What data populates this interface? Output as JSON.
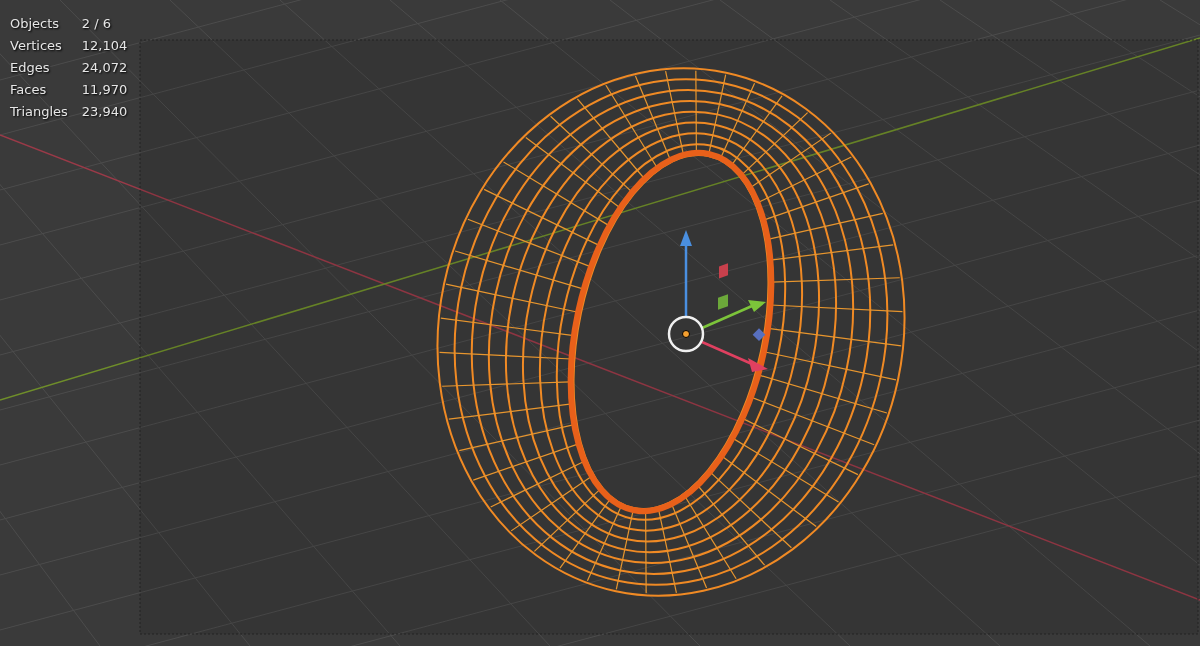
{
  "stats": [
    {
      "label": "Objects",
      "value": "2 / 6"
    },
    {
      "label": "Vertices",
      "value": "12,104"
    },
    {
      "label": "Edges",
      "value": "24,072"
    },
    {
      "label": "Faces",
      "value": "11,970"
    },
    {
      "label": "Triangles",
      "value": "23,940"
    }
  ]
}
